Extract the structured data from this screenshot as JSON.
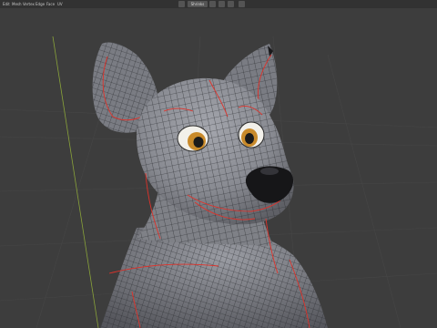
{
  "app": "Blender",
  "header": {
    "menus": [
      "Edit",
      "Mesh",
      "Vertex",
      "Edge",
      "Face",
      "UV"
    ],
    "shading_mode": "Shrinks"
  },
  "viewport": {
    "mode": "Edit Mode",
    "object": "stylized cartoon fox bust, wireframe mesh with red UV seams"
  },
  "colors": {
    "background": "#3d3d3d",
    "mesh_base": "#8a8c92",
    "wire": "#1e1e22",
    "seam": "#e0322a",
    "eye_iris": "#c98a2a",
    "axis_y": "#8aa43a"
  }
}
